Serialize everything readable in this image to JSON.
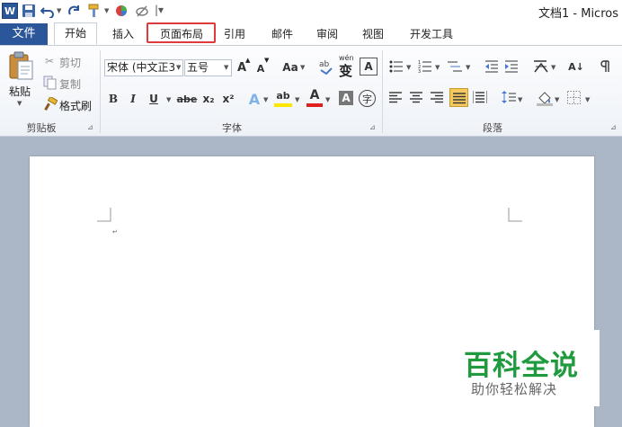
{
  "window": {
    "title": "文档1 - Micros"
  },
  "quick_access": {
    "customize_glyph": "|▾"
  },
  "tabs": {
    "file": "文件",
    "home": "开始",
    "insert": "插入",
    "page_layout": "页面布局",
    "references": "引用",
    "mailings": "邮件",
    "review": "审阅",
    "view": "视图",
    "developer": "开发工具"
  },
  "clipboard": {
    "paste": "粘贴",
    "cut": "剪切",
    "copy": "复制",
    "format_painter": "格式刷",
    "group_label": "剪贴板"
  },
  "font": {
    "font_name": "宋体 (中文正3",
    "font_size": "五号",
    "grow": "A",
    "shrink": "A",
    "change_case": "Aa",
    "bold": "B",
    "italic": "I",
    "underline": "U",
    "strike": "abe",
    "subscript": "x₂",
    "superscript": "x²",
    "text_effect": "A",
    "highlight": "ab",
    "font_color": "A",
    "char_shading": "A",
    "enclose": "字",
    "phonetic": "wén",
    "phonetic_char": "变",
    "char_border": "A",
    "group_label": "字体"
  },
  "paragraph": {
    "sort": "A↓",
    "group_label": "段落"
  },
  "document": {
    "cursor_mark": "↵"
  },
  "watermark": {
    "main": "百科全说",
    "sub": "助你轻松解决"
  },
  "colors": {
    "file_tab": "#2b579a",
    "highlight_outline": "#e03b3b",
    "watermark_green": "#1f9a3e",
    "doc_background": "#abb7c7",
    "highlight_yellow": "#ffe600",
    "font_color_red": "#e02020",
    "justify_active": "#f4c95d"
  }
}
